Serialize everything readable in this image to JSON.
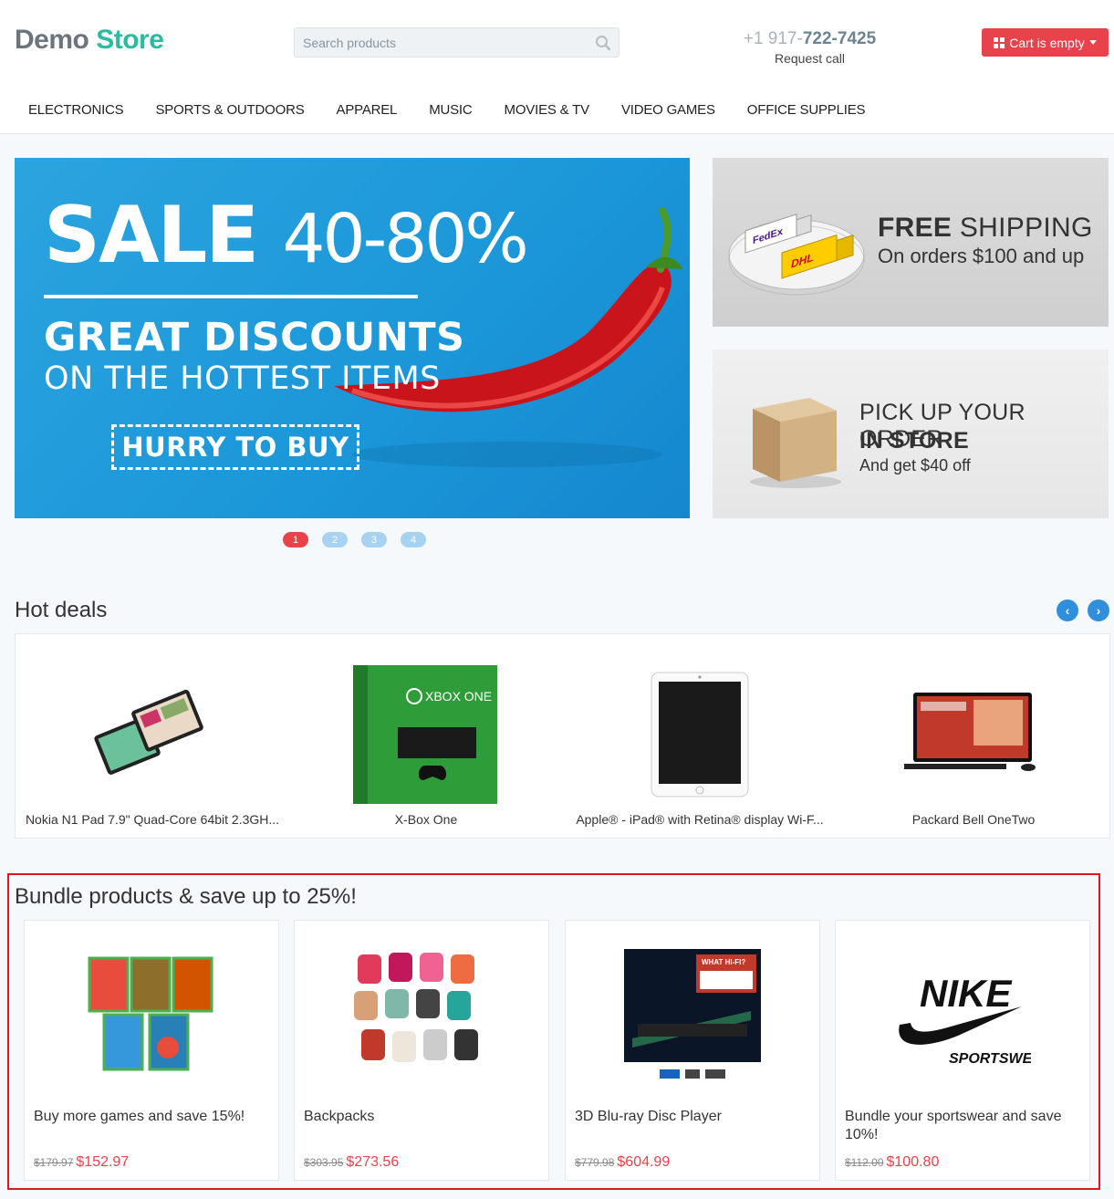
{
  "header": {
    "logo_demo": "Demo",
    "logo_store": "Store",
    "search_placeholder": "Search products",
    "phone_prefix": "+1 917-",
    "phone_number": "722-7425",
    "phone_label": "Request call",
    "cart_label": "Cart is empty"
  },
  "nav": [
    "ELECTRONICS",
    "SPORTS & OUTDOORS",
    "APPAREL",
    "MUSIC",
    "MOVIES & TV",
    "VIDEO GAMES",
    "OFFICE SUPPLIES"
  ],
  "hero": {
    "sale_word": "SALE",
    "sale_range": "40-80%",
    "line1": "GREAT DISCOUNTS",
    "line2": "ON THE HOTTEST ITEMS",
    "cta": "HURRY TO BUY"
  },
  "slider_dots": [
    "1",
    "2",
    "3",
    "4"
  ],
  "promos": {
    "shipping_bold": "FREE",
    "shipping_rest": " SHIPPING",
    "shipping_sub": "On orders $100 and up",
    "pickup_line1": "PICK UP YOUR ORDER",
    "pickup_line2": "IN STORE",
    "pickup_sub": "And get $40 off",
    "truck1_text": "FedEx",
    "truck2_text": "DHL"
  },
  "hot_deals": {
    "title": "Hot deals",
    "items": [
      {
        "name": "Nokia N1 Pad 7.9\" Quad-Core 64bit 2.3GH..."
      },
      {
        "name": "X-Box One",
        "box_text": "XBOX ONE"
      },
      {
        "name": "Apple® - iPad® with Retina® display Wi-F..."
      },
      {
        "name": "Packard Bell OneTwo"
      }
    ]
  },
  "bundles": {
    "title": "Bundle products & save up to 25%!",
    "items": [
      {
        "name": "Buy more games and save 15%!",
        "old_price": "$179.97",
        "new_price": "$152.97"
      },
      {
        "name": "Backpacks",
        "old_price": "$303.95",
        "new_price": "$273.56"
      },
      {
        "name": "3D Blu-ray Disc Player",
        "old_price": "$779.98",
        "new_price": "$604.99",
        "badge_text": "WHAT HI-FI?"
      },
      {
        "name": "Bundle your sportswear and save 10%!",
        "old_price": "$112.00",
        "new_price": "$100.80",
        "logo_word": "NIKE",
        "logo_sub": "SPORTSWEAR"
      }
    ]
  }
}
